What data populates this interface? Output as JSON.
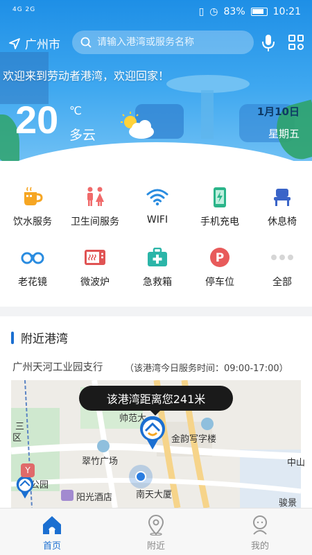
{
  "status_bar": {
    "signal": "4G 2G",
    "battery": "83%",
    "time": "10:21"
  },
  "header": {
    "city": "广州市",
    "search_placeholder": "请输入港湾或服务名称",
    "welcome": "欢迎来到劳动者港湾，欢迎回家！"
  },
  "weather": {
    "temperature": "20",
    "unit": "℃",
    "condition": "多云",
    "date": "1月10日",
    "weekday": "星期五",
    "icon": "partly-cloudy-icon"
  },
  "services": [
    {
      "label": "饮水服务",
      "icon": "water-cup-icon"
    },
    {
      "label": "卫生间服务",
      "icon": "restroom-icon"
    },
    {
      "label": "WIFI",
      "icon": "wifi-icon"
    },
    {
      "label": "手机充电",
      "icon": "phone-charge-icon"
    },
    {
      "label": "休息椅",
      "icon": "chair-icon"
    },
    {
      "label": "老花镜",
      "icon": "glasses-icon"
    },
    {
      "label": "微波炉",
      "icon": "microwave-icon"
    },
    {
      "label": "急救箱",
      "icon": "first-aid-icon"
    },
    {
      "label": "停车位",
      "icon": "parking-icon"
    },
    {
      "label": "全部",
      "icon": "more-icon"
    }
  ],
  "nearby": {
    "title": "附近港湾",
    "name": "广州天河工业园支行",
    "hours": "（该港湾今日服务时间：09:00-17:00）",
    "distance_tip": "该港湾距离您241米",
    "map_labels": [
      "金韵写字楼",
      "翠竹广场",
      "阳光酒店",
      "南天大厦",
      "帅范大",
      "中山",
      "骏景",
      "三",
      "区",
      "公园"
    ]
  },
  "tabs": [
    {
      "label": "首页",
      "icon": "home-icon",
      "active": true
    },
    {
      "label": "附近",
      "icon": "location-icon",
      "active": false
    },
    {
      "label": "我的",
      "icon": "profile-icon",
      "active": false
    }
  ],
  "colors": {
    "primary": "#1b6fd1",
    "hero": "#3fa8f0"
  }
}
